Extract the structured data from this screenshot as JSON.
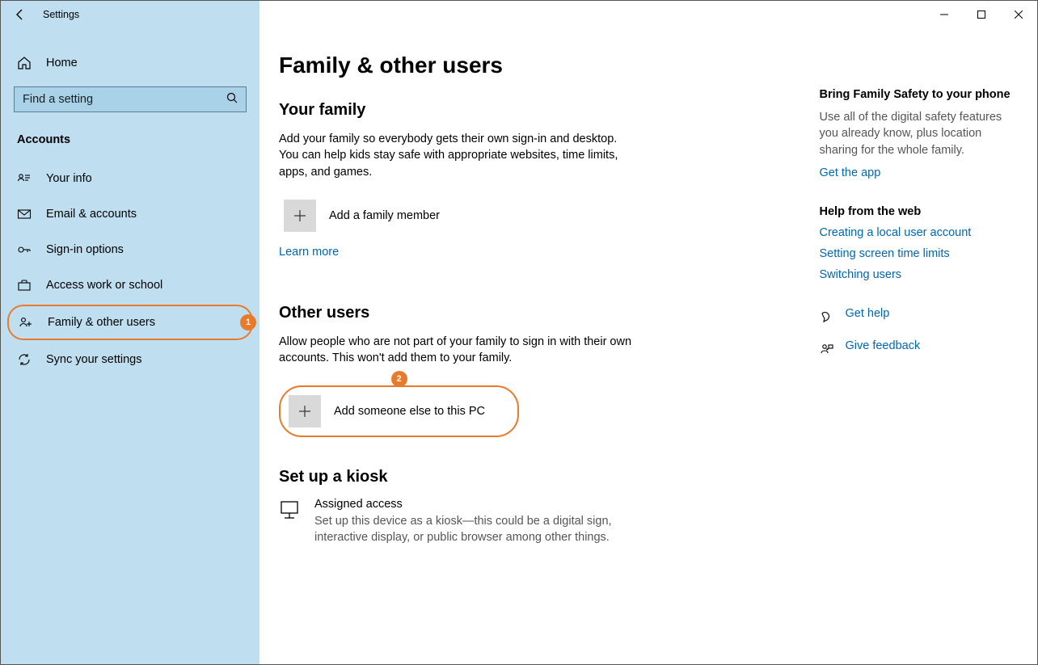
{
  "titlebar": {
    "app_name": "Settings"
  },
  "sidebar": {
    "home": "Home",
    "search_placeholder": "Find a setting",
    "section_label": "Accounts",
    "items": [
      {
        "label": "Your info"
      },
      {
        "label": "Email & accounts"
      },
      {
        "label": "Sign-in options"
      },
      {
        "label": "Access work or school"
      },
      {
        "label": "Family & other users"
      },
      {
        "label": "Sync your settings"
      }
    ]
  },
  "annotations": {
    "badge1": "1",
    "badge2": "2"
  },
  "page": {
    "title": "Family & other users",
    "your_family": {
      "heading": "Your family",
      "desc": "Add your family so everybody gets their own sign-in and desktop. You can help kids stay safe with appropriate websites, time limits, apps, and games.",
      "add_label": "Add a family member",
      "learn_more": "Learn more"
    },
    "other_users": {
      "heading": "Other users",
      "desc": "Allow people who are not part of your family to sign in with their own accounts. This won't add them to your family.",
      "add_label": "Add someone else to this PC"
    },
    "kiosk": {
      "heading": "Set up a kiosk",
      "title": "Assigned access",
      "desc": "Set up this device as a kiosk—this could be a digital sign, interactive display, or public browser among other things."
    }
  },
  "right": {
    "family_safety": {
      "heading": "Bring Family Safety to your phone",
      "desc": "Use all of the digital safety features you already know, plus location sharing for the whole family.",
      "link": "Get the app"
    },
    "help_web": {
      "heading": "Help from the web",
      "links": [
        "Creating a local user account",
        "Setting screen time limits",
        "Switching users"
      ]
    },
    "get_help": "Get help",
    "give_feedback": "Give feedback"
  }
}
